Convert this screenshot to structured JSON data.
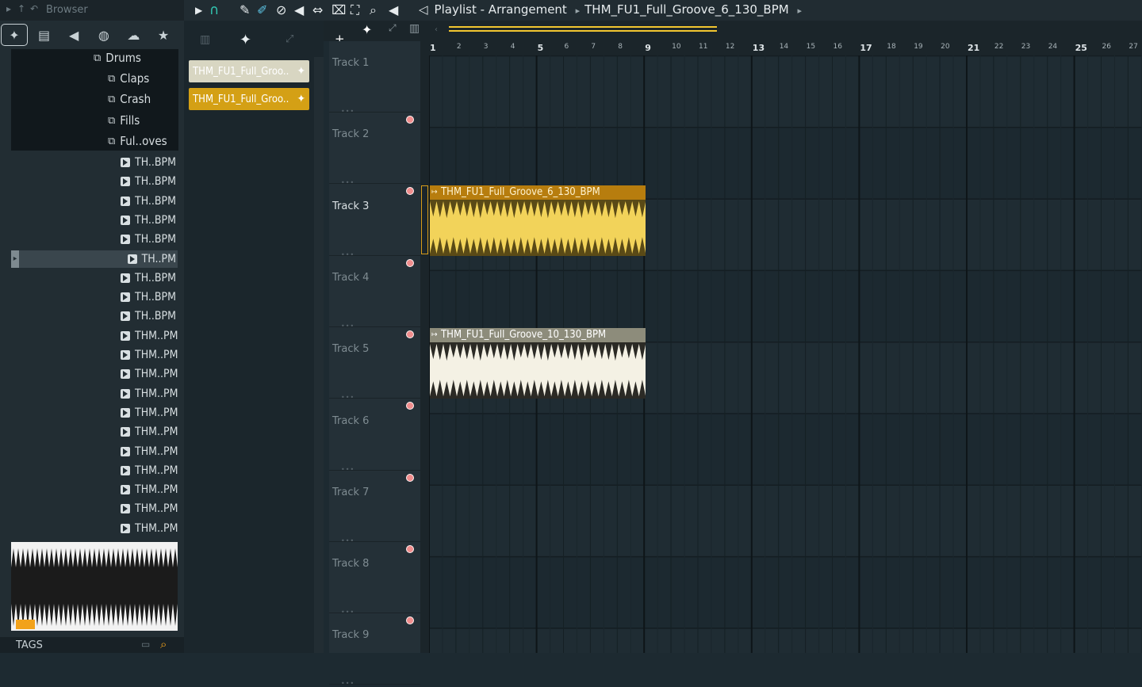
{
  "browser": {
    "title": "Browser",
    "tabs": [
      {
        "icon": "waveform-icon",
        "glyph": "✦"
      },
      {
        "icon": "document-icon",
        "glyph": "▤"
      },
      {
        "icon": "speaker-icon",
        "glyph": "◀"
      },
      {
        "icon": "globe-icon",
        "glyph": "◍"
      },
      {
        "icon": "cloud-icon",
        "glyph": "☁"
      },
      {
        "icon": "star-icon",
        "glyph": "★"
      }
    ],
    "folders": [
      "Drums",
      "Claps",
      "Crash",
      "Fills",
      "Ful..oves"
    ],
    "files": [
      "TH..BPM",
      "TH..BPM",
      "TH..BPM",
      "TH..BPM",
      "TH..BPM",
      "TH..PM",
      "TH..BPM",
      "TH..BPM",
      "TH..BPM",
      "THM..PM",
      "THM..PM",
      "THM..PM",
      "THM..PM",
      "THM..PM",
      "THM..PM",
      "THM..PM",
      "THM..PM",
      "THM..PM",
      "THM..PM",
      "THM..PM"
    ],
    "selected_file_index": 5,
    "tags_label": "TAGS"
  },
  "picker": {
    "clips": [
      {
        "label": "THM_FU1_Full_Groo..",
        "color": "#d8d6c2",
        "text_color": "#ffffff"
      },
      {
        "label": "THM_FU1_Full_Groo..",
        "color": "#d4a015",
        "text_color": "#ffffff"
      }
    ]
  },
  "toolbar": {
    "title": "Playlist - Arrangement",
    "separator": "▸",
    "pattern": "THM_FU1_Full_Groove_6_130_BPM"
  },
  "ruler": {
    "bars": [
      "1",
      "2",
      "3",
      "4",
      "5",
      "6",
      "7",
      "8",
      "9",
      "10",
      "11",
      "12",
      "13",
      "14",
      "15",
      "16",
      "17",
      "18",
      "19",
      "20",
      "21",
      "22",
      "23",
      "24",
      "25",
      "26",
      "27"
    ]
  },
  "tracks": [
    "Track 1",
    "Track 2",
    "Track 3",
    "Track 4",
    "Track 5",
    "Track 6",
    "Track 7",
    "Track 8",
    "Track 9"
  ],
  "active_track_index": 2,
  "clips": [
    {
      "label": "THM_FU1_Full_Groove_6_130_BPM",
      "track": 3,
      "bars": 8,
      "header_color": "#b77d0e",
      "body_color": "#5a4a16",
      "wave_color": "#f2d35a",
      "text_color": "#fff3cf"
    },
    {
      "label": "THM_FU1_Full_Groove_10_130_BPM",
      "track": 5,
      "bars": 8,
      "header_color": "#8d8c7b",
      "body_color": "#2b2a25",
      "wave_color": "#f4f1e4",
      "text_color": "#ffffff"
    }
  ],
  "colors": {
    "accent": "#f2c630",
    "record_dot": "#f08d8d",
    "background": "#1d2a31"
  }
}
